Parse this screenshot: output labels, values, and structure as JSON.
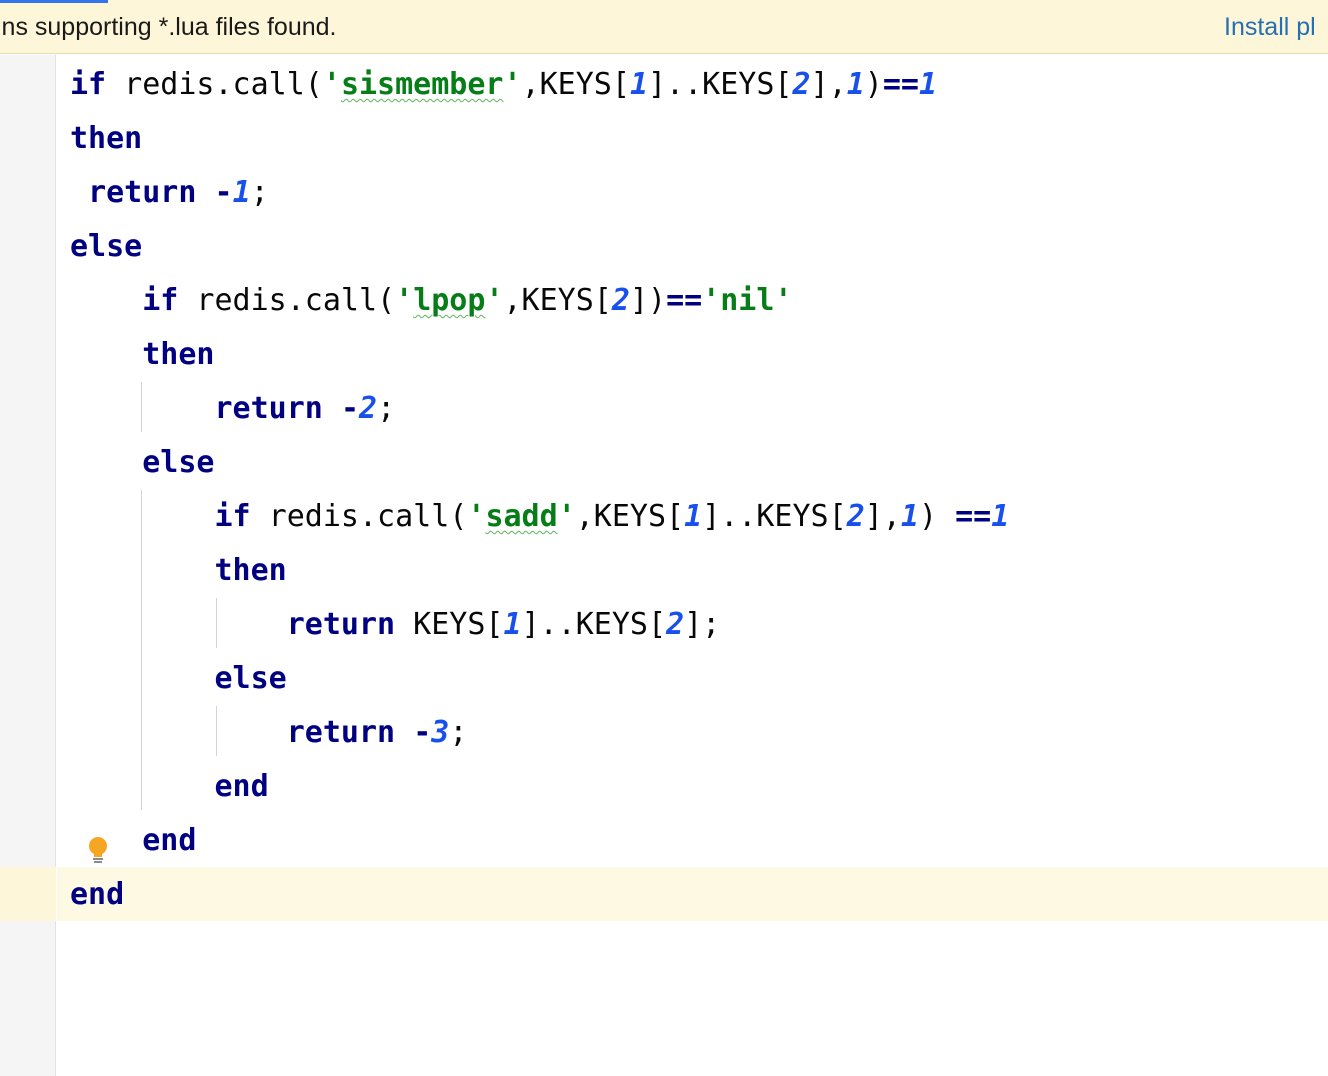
{
  "notification": {
    "text": "ins supporting *.lua files found.",
    "action_label": "Install pl"
  },
  "editor": {
    "language": "lua",
    "lines": [
      [
        {
          "t": "if",
          "c": "kw"
        },
        {
          "t": " redis.call(",
          "c": ""
        },
        {
          "t": "'",
          "c": "str"
        },
        {
          "t": "sismember",
          "c": "str typo"
        },
        {
          "t": "'",
          "c": "str"
        },
        {
          "t": ",KEYS[",
          "c": ""
        },
        {
          "t": "1",
          "c": "num"
        },
        {
          "t": "]..KEYS[",
          "c": ""
        },
        {
          "t": "2",
          "c": "num"
        },
        {
          "t": "],",
          "c": ""
        },
        {
          "t": "1",
          "c": "num"
        },
        {
          "t": ")",
          "c": ""
        },
        {
          "t": "==",
          "c": "op"
        },
        {
          "t": "1",
          "c": "num"
        }
      ],
      [
        {
          "t": "then",
          "c": "kw"
        }
      ],
      [
        {
          "t": " ",
          "c": ""
        },
        {
          "t": "return",
          "c": "kw"
        },
        {
          "t": " ",
          "c": ""
        },
        {
          "t": "-",
          "c": "op"
        },
        {
          "t": "1",
          "c": "num"
        },
        {
          "t": ";",
          "c": ""
        }
      ],
      [
        {
          "t": "else",
          "c": "kw"
        }
      ],
      [
        {
          "t": "    ",
          "c": ""
        },
        {
          "t": "if",
          "c": "kw"
        },
        {
          "t": " redis.call(",
          "c": ""
        },
        {
          "t": "'",
          "c": "str"
        },
        {
          "t": "lpop",
          "c": "str typo"
        },
        {
          "t": "'",
          "c": "str"
        },
        {
          "t": ",KEYS[",
          "c": ""
        },
        {
          "t": "2",
          "c": "num"
        },
        {
          "t": "])",
          "c": ""
        },
        {
          "t": "==",
          "c": "op"
        },
        {
          "t": "'nil'",
          "c": "str"
        }
      ],
      [
        {
          "t": "    ",
          "c": ""
        },
        {
          "t": "then",
          "c": "kw"
        }
      ],
      [
        {
          "t": "        ",
          "c": ""
        },
        {
          "t": "return",
          "c": "kw"
        },
        {
          "t": " ",
          "c": ""
        },
        {
          "t": "-",
          "c": "op"
        },
        {
          "t": "2",
          "c": "num"
        },
        {
          "t": ";",
          "c": ""
        }
      ],
      [
        {
          "t": "    ",
          "c": ""
        },
        {
          "t": "else",
          "c": "kw"
        }
      ],
      [
        {
          "t": "        ",
          "c": ""
        },
        {
          "t": "if",
          "c": "kw"
        },
        {
          "t": " redis.call(",
          "c": ""
        },
        {
          "t": "'",
          "c": "str"
        },
        {
          "t": "sadd",
          "c": "str typo"
        },
        {
          "t": "'",
          "c": "str"
        },
        {
          "t": ",KEYS[",
          "c": ""
        },
        {
          "t": "1",
          "c": "num"
        },
        {
          "t": "]..KEYS[",
          "c": ""
        },
        {
          "t": "2",
          "c": "num"
        },
        {
          "t": "],",
          "c": ""
        },
        {
          "t": "1",
          "c": "num"
        },
        {
          "t": ") ",
          "c": ""
        },
        {
          "t": "==",
          "c": "op"
        },
        {
          "t": "1",
          "c": "num"
        }
      ],
      [
        {
          "t": "        ",
          "c": ""
        },
        {
          "t": "then",
          "c": "kw"
        }
      ],
      [
        {
          "t": "            ",
          "c": ""
        },
        {
          "t": "return",
          "c": "kw"
        },
        {
          "t": " KEYS[",
          "c": ""
        },
        {
          "t": "1",
          "c": "num"
        },
        {
          "t": "]..KEYS[",
          "c": ""
        },
        {
          "t": "2",
          "c": "num"
        },
        {
          "t": "];",
          "c": ""
        }
      ],
      [
        {
          "t": "        ",
          "c": ""
        },
        {
          "t": "else",
          "c": "kw"
        }
      ],
      [
        {
          "t": "            ",
          "c": ""
        },
        {
          "t": "return",
          "c": "kw"
        },
        {
          "t": " ",
          "c": ""
        },
        {
          "t": "-",
          "c": "op"
        },
        {
          "t": "3",
          "c": "num"
        },
        {
          "t": ";",
          "c": ""
        }
      ],
      [
        {
          "t": "        ",
          "c": ""
        },
        {
          "t": "end",
          "c": "kw"
        }
      ],
      [
        {
          "t": "    ",
          "c": ""
        },
        {
          "t": "end",
          "c": "kw"
        }
      ],
      [
        {
          "t": "end",
          "c": "kw"
        }
      ]
    ]
  },
  "colors": {
    "keyword": "#000080",
    "string": "#067d17",
    "number": "#1750eb",
    "notification_bg": "#fdf6d8",
    "link": "#2470b3",
    "current_line": "#fef9e3"
  },
  "icons": {
    "intention": "lightbulb-icon"
  }
}
